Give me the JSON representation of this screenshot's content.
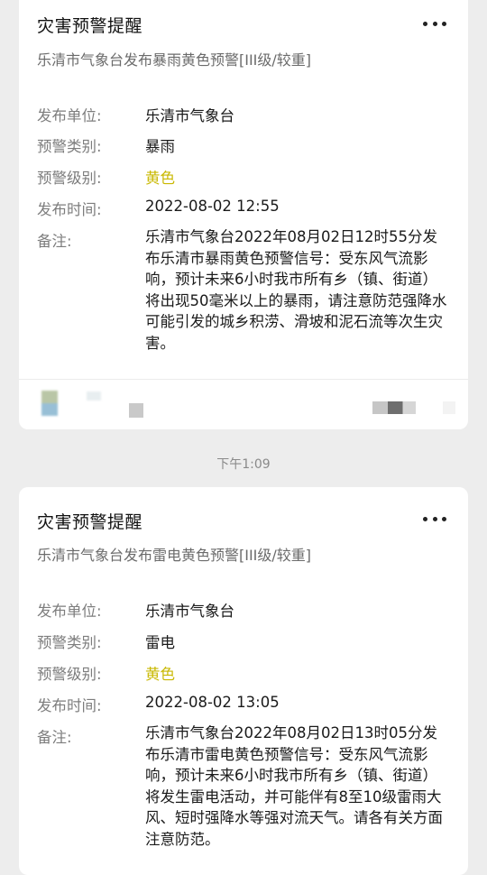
{
  "messages": [
    {
      "title": "灾害预警提醒",
      "subtitle": "乐清市气象台发布暴雨黄色预警[III级/较重]",
      "fields": {
        "issuer_label": "发布单位:",
        "issuer": "乐清市气象台",
        "type_label": "预警类别:",
        "type": "暴雨",
        "level_label": "预警级别:",
        "level": "黄色",
        "time_label": "发布时间:",
        "time": "2022-08-02 12:55",
        "note_label": "备注:",
        "note": "乐清市气象台2022年08月02日12时55分发布乐清市暴雨黄色预警信号：受东风气流影响，预计未来6小时我市所有乡（镇、街道）将出现50毫米以上的暴雨，请注意防范强降水可能引发的城乡积涝、滑坡和泥石流等次生灾害。"
      }
    },
    {
      "title": "灾害预警提醒",
      "subtitle": "乐清市气象台发布雷电黄色预警[III级/较重]",
      "fields": {
        "issuer_label": "发布单位:",
        "issuer": "乐清市气象台",
        "type_label": "预警类别:",
        "type": "雷电",
        "level_label": "预警级别:",
        "level": "黄色",
        "time_label": "发布时间:",
        "time": "2022-08-02 13:05",
        "note_label": "备注:",
        "note": "乐清市气象台2022年08月02日13时05分发布乐清市雷电黄色预警信号：受东风气流影响，预计未来6小时我市所有乡（镇、街道）将发生雷电活动，并可能伴有8至10级雷雨大风、短时强降水等强对流天气。请各有关方面注意防范。"
      }
    }
  ],
  "timestamp": "下午1:09",
  "colors": {
    "level_yellow": "#c9b800",
    "background": "#ededed",
    "card": "#ffffff"
  },
  "icons": {
    "more": "more-dots-icon"
  }
}
